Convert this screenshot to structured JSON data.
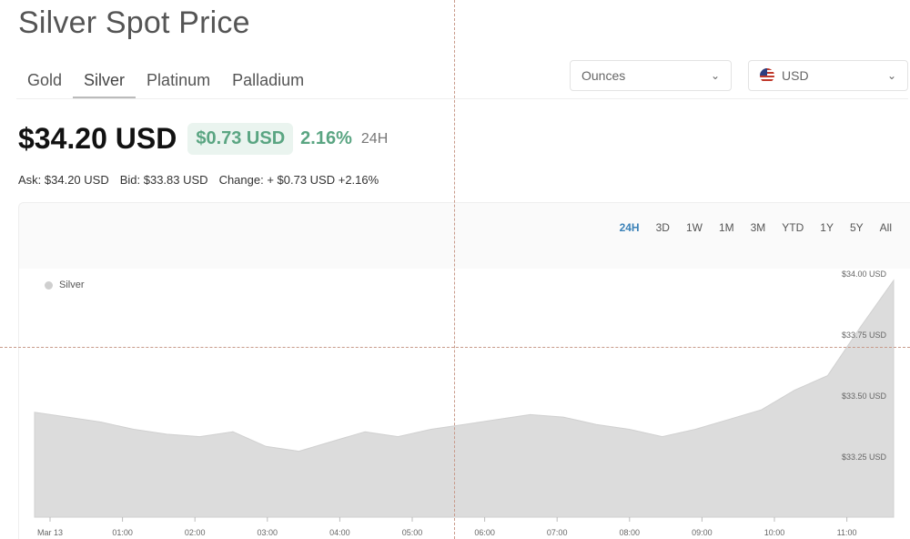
{
  "page": {
    "title": "Silver Spot Price"
  },
  "tabs": [
    {
      "label": "Gold"
    },
    {
      "label": "Silver"
    },
    {
      "label": "Platinum"
    },
    {
      "label": "Palladium"
    }
  ],
  "unit_select": {
    "value": "Ounces"
  },
  "currency_select": {
    "value": "USD"
  },
  "price": {
    "value": "$34.20 USD",
    "change": "$0.73 USD",
    "change_pct": "2.16%",
    "period": "24H"
  },
  "meta": {
    "ask": "Ask: $34.20 USD",
    "bid": "Bid: $33.83 USD",
    "change": "Change: + $0.73 USD +2.16%"
  },
  "ranges": [
    "24H",
    "3D",
    "1W",
    "1M",
    "3M",
    "YTD",
    "1Y",
    "5Y",
    "All"
  ],
  "colors": {
    "area_fill": "#dcdcdc",
    "area_line": "#d0d0d0",
    "positive": "#5aa582",
    "active_range": "#3b82b8",
    "crosshair": "#c89a8a"
  },
  "chart_data": {
    "type": "area",
    "legend": [
      "Silver"
    ],
    "legend_position": "top-left",
    "x": [
      "Mar 13",
      "00:30",
      "01:00",
      "01:30",
      "02:00",
      "02:30",
      "03:00",
      "03:30",
      "04:00",
      "04:15",
      "04:30",
      "05:00",
      "05:30",
      "06:00",
      "06:30",
      "07:00",
      "07:30",
      "08:00",
      "08:30",
      "09:00",
      "09:15",
      "09:30",
      "10:00",
      "10:30",
      "11:00",
      "11:30",
      "11:45"
    ],
    "series": [
      {
        "name": "Silver",
        "values": [
          33.43,
          33.41,
          33.39,
          33.36,
          33.34,
          33.33,
          33.35,
          33.29,
          33.27,
          33.31,
          33.35,
          33.33,
          33.36,
          33.38,
          33.4,
          33.42,
          33.41,
          33.38,
          33.36,
          33.33,
          33.36,
          33.4,
          33.44,
          33.52,
          33.58,
          33.78,
          33.97
        ]
      }
    ],
    "xticks": [
      "Mar 13",
      "01:00",
      "02:00",
      "03:00",
      "04:00",
      "05:00",
      "06:00",
      "07:00",
      "08:00",
      "09:00",
      "10:00",
      "11:00"
    ],
    "yticks": [
      "$33.25 USD",
      "$33.50 USD",
      "$33.75 USD",
      "$34.00 USD"
    ],
    "ytick_values": [
      33.25,
      33.5,
      33.75,
      34.0
    ],
    "ylim": [
      33.0,
      34.0
    ],
    "grid": false,
    "crosshair": {
      "x": "05:45",
      "y": 34.0
    }
  }
}
